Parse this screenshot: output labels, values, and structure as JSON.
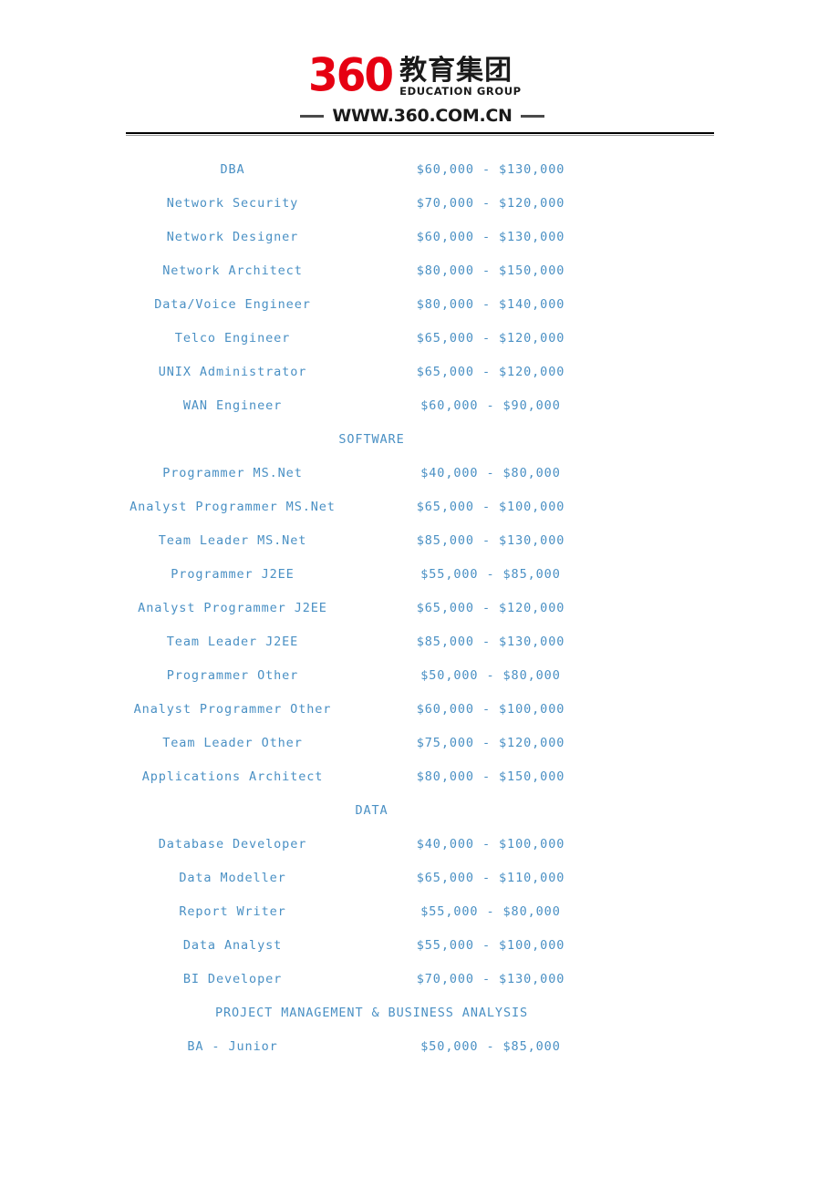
{
  "header": {
    "logo": {
      "mark_text": "360",
      "chinese_name": "教育集团",
      "english_name": "EDUCATION GROUP",
      "url": "WWW.360.COM.CN",
      "mark_color": "#e60012",
      "text_color": "#1a1a1a"
    }
  },
  "document": {
    "text_color": "#4a90c4",
    "columns": {
      "role": "",
      "salary_range": ""
    },
    "rows": [
      {
        "kind": "entry",
        "role": "DBA",
        "salary": "$60,000 - $130,000"
      },
      {
        "kind": "entry",
        "role": "Network Security",
        "salary": "$70,000 - $120,000"
      },
      {
        "kind": "entry",
        "role": "Network Designer",
        "salary": "$60,000 - $130,000"
      },
      {
        "kind": "entry",
        "role": "Network Architect",
        "salary": "$80,000 - $150,000"
      },
      {
        "kind": "entry",
        "role": "Data/Voice Engineer",
        "salary": "$80,000 - $140,000"
      },
      {
        "kind": "entry",
        "role": "Telco Engineer",
        "salary": "$65,000 - $120,000"
      },
      {
        "kind": "entry",
        "role": "UNIX Administrator",
        "salary": "$65,000 - $120,000"
      },
      {
        "kind": "entry",
        "role": "WAN Engineer",
        "salary": "$60,000 - $90,000"
      },
      {
        "kind": "section",
        "role": "SOFTWARE",
        "salary": ""
      },
      {
        "kind": "entry",
        "role": "Programmer MS.Net",
        "salary": "$40,000 - $80,000"
      },
      {
        "kind": "entry",
        "role": "Analyst Programmer MS.Net",
        "salary": "$65,000 - $100,000"
      },
      {
        "kind": "entry",
        "role": "Team Leader MS.Net",
        "salary": "$85,000 - $130,000"
      },
      {
        "kind": "entry",
        "role": "Programmer J2EE",
        "salary": "$55,000 - $85,000"
      },
      {
        "kind": "entry",
        "role": "Analyst Programmer J2EE",
        "salary": "$65,000 - $120,000"
      },
      {
        "kind": "entry",
        "role": "Team Leader J2EE",
        "salary": "$85,000 - $130,000"
      },
      {
        "kind": "entry",
        "role": "Programmer Other",
        "salary": "$50,000 - $80,000"
      },
      {
        "kind": "entry",
        "role": "Analyst Programmer Other",
        "salary": "$60,000 - $100,000"
      },
      {
        "kind": "entry",
        "role": "Team Leader Other",
        "salary": "$75,000 - $120,000"
      },
      {
        "kind": "entry",
        "role": "Applications Architect",
        "salary": "$80,000 - $150,000"
      },
      {
        "kind": "section",
        "role": "DATA",
        "salary": ""
      },
      {
        "kind": "entry",
        "role": "Database Developer",
        "salary": "$40,000 - $100,000"
      },
      {
        "kind": "entry",
        "role": "Data Modeller",
        "salary": "$65,000 - $110,000"
      },
      {
        "kind": "entry",
        "role": "Report Writer",
        "salary": "$55,000 - $80,000"
      },
      {
        "kind": "entry",
        "role": "Data Analyst",
        "salary": "$55,000 - $100,000"
      },
      {
        "kind": "entry",
        "role": "BI Developer",
        "salary": "$70,000 - $130,000"
      },
      {
        "kind": "section",
        "role": "PROJECT MANAGEMENT & BUSINESS ANALYSIS",
        "salary": ""
      },
      {
        "kind": "entry",
        "role": "BA - Junior",
        "salary": "$50,000 - $85,000"
      }
    ]
  }
}
